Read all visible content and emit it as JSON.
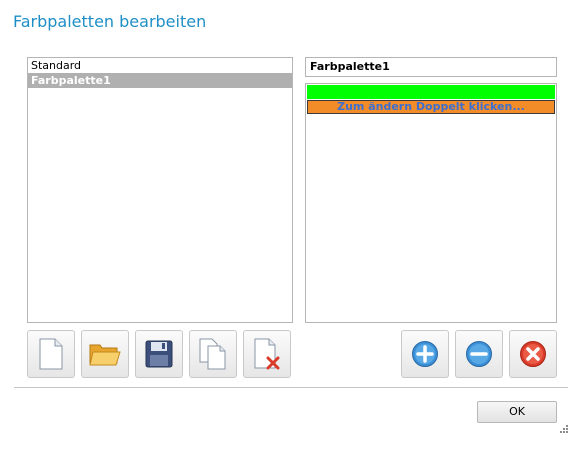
{
  "dialog": {
    "title": "Farbpaletten bearbeiten"
  },
  "palettes": {
    "items": [
      {
        "label": "Standard",
        "selected": false
      },
      {
        "label": "Farbpalette1",
        "selected": true
      }
    ]
  },
  "palette_name": {
    "value": "Farbpalette1"
  },
  "colors": {
    "entries": [
      {
        "color": "#00ff00",
        "label": ""
      },
      {
        "color": "#f28c28",
        "label": "Zum ändern Doppelt klicken..."
      }
    ]
  },
  "toolbar_left": {
    "icons": [
      "new-document-icon",
      "open-folder-icon",
      "save-disk-icon",
      "copy-document-icon",
      "delete-document-icon"
    ]
  },
  "toolbar_right": {
    "icons": [
      "add-circle-icon",
      "remove-circle-icon",
      "delete-circle-icon"
    ]
  },
  "footer": {
    "ok_label": "OK"
  },
  "theme": {
    "accent": "#1e8fc6",
    "selection": "#b0b0b0",
    "add_blue": "#3b8fd6",
    "delete_red": "#d93a2a"
  }
}
